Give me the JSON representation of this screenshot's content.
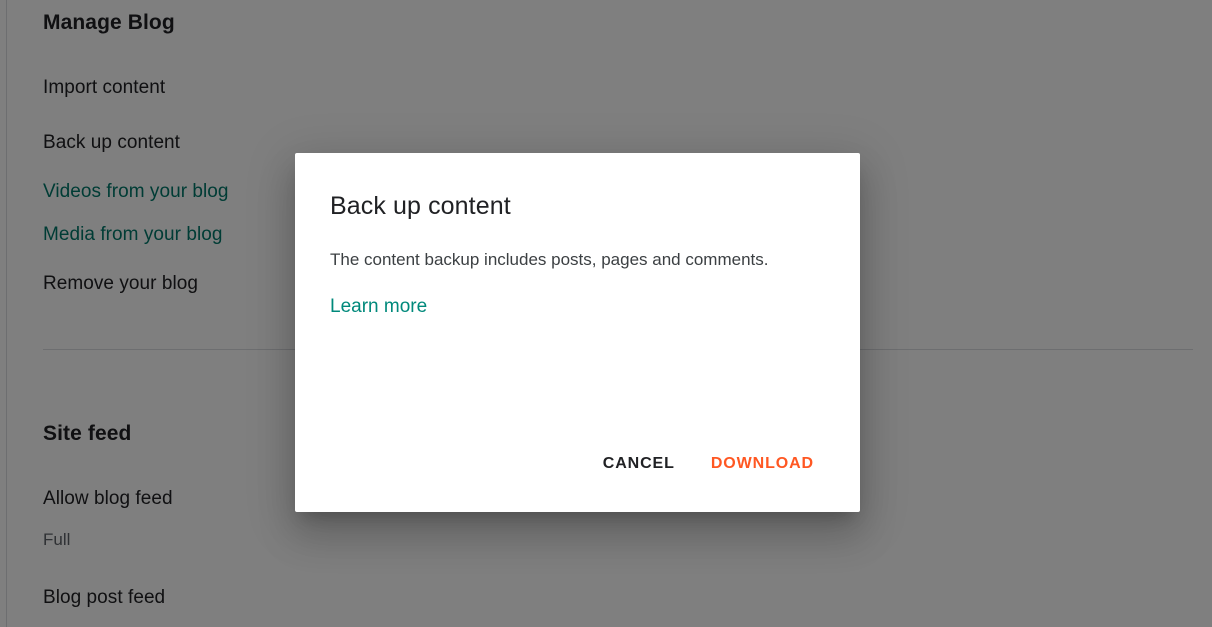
{
  "page": {
    "manage_blog": {
      "title": "Manage Blog",
      "items": [
        {
          "label": "Import content",
          "kind": "action"
        },
        {
          "label": "Back up content",
          "kind": "action"
        },
        {
          "label": "Videos from your blog",
          "kind": "link"
        },
        {
          "label": "Media from your blog",
          "kind": "link"
        },
        {
          "label": "Remove your blog",
          "kind": "action"
        }
      ]
    },
    "site_feed": {
      "title": "Site feed",
      "items": [
        {
          "label": "Allow blog feed",
          "value": "Full"
        },
        {
          "label": "Blog post feed",
          "value": ""
        }
      ]
    }
  },
  "dialog": {
    "title": "Back up content",
    "body": "The content backup includes posts, pages and comments.",
    "learn_more": "Learn more",
    "cancel_label": "CANCEL",
    "confirm_label": "DOWNLOAD"
  },
  "colors": {
    "link_teal": "#00897B",
    "sidebar_link_teal": "#00796B",
    "confirm_orange": "#FF5722",
    "text_primary": "#202124",
    "text_secondary": "#5F6368",
    "scrim": "rgba(0,0,0,0.5)"
  }
}
